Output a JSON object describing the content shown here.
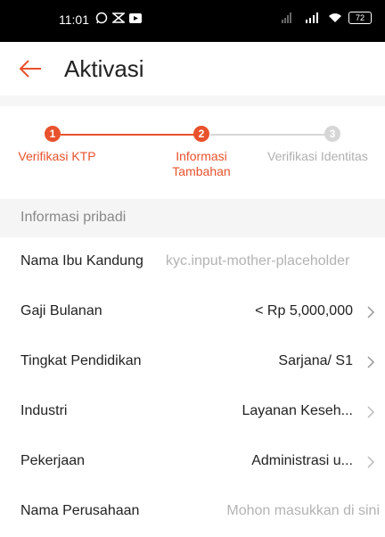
{
  "status_bar": {
    "time": "11:01",
    "battery": "72"
  },
  "header": {
    "title": "Aktivasi"
  },
  "stepper": {
    "active_color": "#e8522c",
    "inactive_color": "#d6d6d6",
    "steps": [
      {
        "number": "1",
        "label_line1": "Verifikasi KTP",
        "label_line2": "",
        "state": "done"
      },
      {
        "number": "2",
        "label_line1": "Informasi",
        "label_line2": "Tambahan",
        "state": "active"
      },
      {
        "number": "3",
        "label_line1": "Verifikasi Identitas",
        "label_line2": "",
        "state": "inactive"
      }
    ]
  },
  "section": {
    "title": "Informasi pribadi"
  },
  "form": {
    "mother_name": {
      "label": "Nama Ibu Kandung",
      "placeholder": "kyc.input-mother-placeholder"
    },
    "salary": {
      "label": "Gaji Bulanan",
      "value": "< Rp 5,000,000"
    },
    "education": {
      "label": "Tingkat Pendidikan",
      "value": "Sarjana/ S1"
    },
    "industry": {
      "label": "Industri",
      "value": "Layanan Keseh..."
    },
    "occupation": {
      "label": "Pekerjaan",
      "value": "Administrasi u..."
    },
    "company": {
      "label": "Nama Perusahaan",
      "placeholder": "Mohon masukkan di sini"
    }
  }
}
